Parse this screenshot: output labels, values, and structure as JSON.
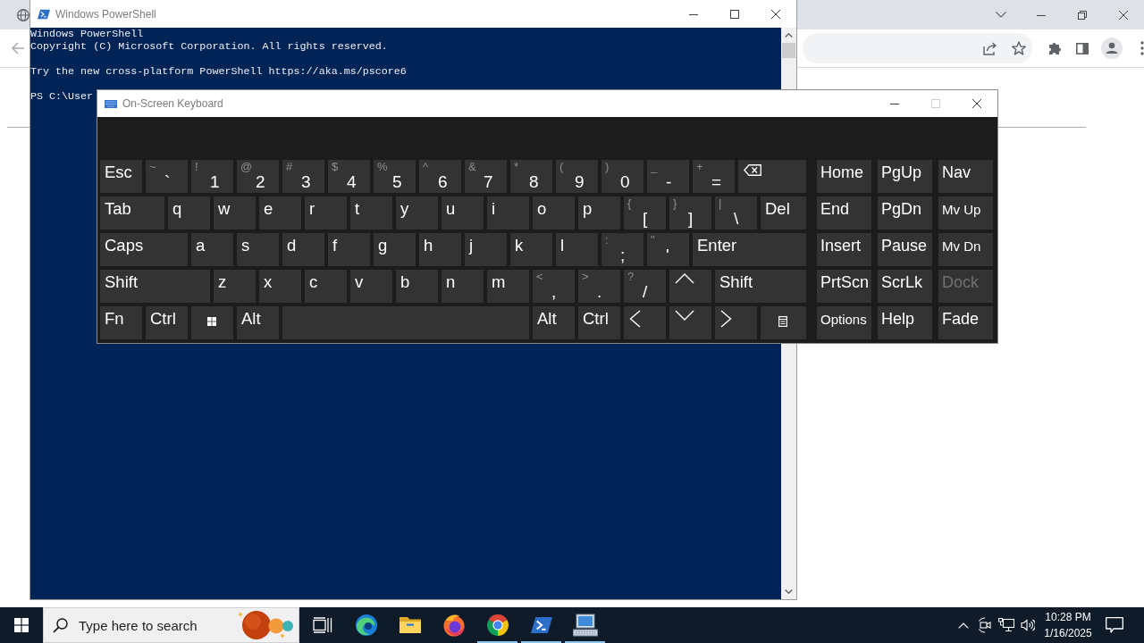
{
  "browser": {
    "back_disabled": true
  },
  "powershell": {
    "title": "Windows PowerShell",
    "console": [
      [
        "Windows PowerShell",
        "Copyright (C) Microsoft Corporation. All rights reserved."
      ],
      [
        "Try the new cross-platform PowerShell https://aka.ms/pscore6"
      ],
      [
        "PS C:\\User"
      ]
    ]
  },
  "keyboard": {
    "title": "On-Screen Keyboard",
    "maximize_disabled": true,
    "rows": [
      {
        "keys": [
          {
            "kind": "label",
            "label": "Esc"
          },
          {
            "kind": "symbol",
            "shift": "~",
            "main": "`"
          },
          {
            "kind": "symbol",
            "shift": "!",
            "main": "1"
          },
          {
            "kind": "symbol",
            "shift": "@",
            "main": "2"
          },
          {
            "kind": "symbol",
            "shift": "#",
            "main": "3"
          },
          {
            "kind": "symbol",
            "shift": "$",
            "main": "4"
          },
          {
            "kind": "symbol",
            "shift": "%",
            "main": "5"
          },
          {
            "kind": "symbol",
            "shift": "^",
            "main": "6"
          },
          {
            "kind": "symbol",
            "shift": "&",
            "main": "7"
          },
          {
            "kind": "symbol",
            "shift": "*",
            "main": "8"
          },
          {
            "kind": "symbol",
            "shift": "(",
            "main": "9"
          },
          {
            "kind": "symbol",
            "shift": ")",
            "main": "0"
          },
          {
            "kind": "symbol",
            "shift": "_",
            "main": "-"
          },
          {
            "kind": "symbol",
            "shift": "+",
            "main": "="
          },
          {
            "kind": "backspace"
          }
        ]
      },
      {
        "keys": [
          {
            "kind": "label",
            "label": "Tab"
          },
          {
            "kind": "label",
            "label": "q"
          },
          {
            "kind": "label",
            "label": "w"
          },
          {
            "kind": "label",
            "label": "e"
          },
          {
            "kind": "label",
            "label": "r"
          },
          {
            "kind": "label",
            "label": "t"
          },
          {
            "kind": "label",
            "label": "y"
          },
          {
            "kind": "label",
            "label": "u"
          },
          {
            "kind": "label",
            "label": "i"
          },
          {
            "kind": "label",
            "label": "o"
          },
          {
            "kind": "label",
            "label": "p"
          },
          {
            "kind": "symbol",
            "shift": "{",
            "main": "["
          },
          {
            "kind": "symbol",
            "shift": "}",
            "main": "]"
          },
          {
            "kind": "symbol",
            "shift": "|",
            "main": "\\"
          },
          {
            "kind": "label",
            "label": "Del"
          }
        ]
      },
      {
        "keys": [
          {
            "kind": "label",
            "label": "Caps"
          },
          {
            "kind": "label",
            "label": "a"
          },
          {
            "kind": "label",
            "label": "s"
          },
          {
            "kind": "label",
            "label": "d"
          },
          {
            "kind": "label",
            "label": "f"
          },
          {
            "kind": "label",
            "label": "g"
          },
          {
            "kind": "label",
            "label": "h"
          },
          {
            "kind": "label",
            "label": "j"
          },
          {
            "kind": "label",
            "label": "k"
          },
          {
            "kind": "label",
            "label": "l"
          },
          {
            "kind": "symbol",
            "shift": ":",
            "main": ";"
          },
          {
            "kind": "symbol",
            "shift": "\"",
            "main": "'"
          },
          {
            "kind": "label",
            "label": "Enter"
          }
        ]
      },
      {
        "keys": [
          {
            "kind": "label",
            "label": "Shift"
          },
          {
            "kind": "label",
            "label": "z"
          },
          {
            "kind": "label",
            "label": "x"
          },
          {
            "kind": "label",
            "label": "c"
          },
          {
            "kind": "label",
            "label": "v"
          },
          {
            "kind": "label",
            "label": "b"
          },
          {
            "kind": "label",
            "label": "n"
          },
          {
            "kind": "label",
            "label": "m"
          },
          {
            "kind": "symbol",
            "shift": "<",
            "main": ","
          },
          {
            "kind": "symbol",
            "shift": ">",
            "main": "."
          },
          {
            "kind": "symbol",
            "shift": "?",
            "main": "/"
          },
          {
            "kind": "up"
          },
          {
            "kind": "label",
            "label": "Shift"
          }
        ]
      },
      {
        "keys": [
          {
            "kind": "label",
            "label": "Fn"
          },
          {
            "kind": "label",
            "label": "Ctrl"
          },
          {
            "kind": "windows"
          },
          {
            "kind": "label",
            "label": "Alt"
          },
          {
            "kind": "space"
          },
          {
            "kind": "label",
            "label": "Alt"
          },
          {
            "kind": "label",
            "label": "Ctrl"
          },
          {
            "kind": "left"
          },
          {
            "kind": "down"
          },
          {
            "kind": "right"
          },
          {
            "kind": "menu"
          }
        ]
      }
    ],
    "nav_keys": [
      {
        "label": "Home",
        "kind": "normal",
        "disabled": false
      },
      {
        "label": "PgUp",
        "kind": "normal",
        "disabled": false
      },
      {
        "label": "Nav",
        "kind": "normal",
        "disabled": false
      },
      {
        "label": "End",
        "kind": "normal",
        "disabled": false
      },
      {
        "label": "PgDn",
        "kind": "normal",
        "disabled": false
      },
      {
        "label": "Mv Up",
        "kind": "compact",
        "disabled": false
      },
      {
        "label": "Insert",
        "kind": "normal",
        "disabled": false
      },
      {
        "label": "Pause",
        "kind": "normal",
        "disabled": false
      },
      {
        "label": "Mv Dn",
        "kind": "compact",
        "disabled": false
      },
      {
        "label": "PrtScn",
        "kind": "normal",
        "disabled": false
      },
      {
        "label": "ScrLk",
        "kind": "normal",
        "disabled": false
      },
      {
        "label": "Dock",
        "kind": "normal",
        "disabled": true
      },
      {
        "label": "Options",
        "kind": "compact",
        "disabled": false
      },
      {
        "label": "Help",
        "kind": "normal",
        "disabled": false
      },
      {
        "label": "Fade",
        "kind": "normal",
        "disabled": false
      }
    ]
  },
  "taskbar": {
    "search": {
      "placeholder": "Type here to search"
    },
    "apps": [
      {
        "kind": "taskview",
        "running": false
      },
      {
        "kind": "swirl",
        "running": false
      },
      {
        "kind": "folder",
        "running": false
      },
      {
        "kind": "foxglobe",
        "running": false
      },
      {
        "kind": "tricolor",
        "running": true
      },
      {
        "kind": "terminal",
        "running": true
      },
      {
        "kind": "keyboard",
        "running": true
      }
    ],
    "clock": {
      "time": "10:28 PM",
      "date": "1/16/2025"
    }
  }
}
